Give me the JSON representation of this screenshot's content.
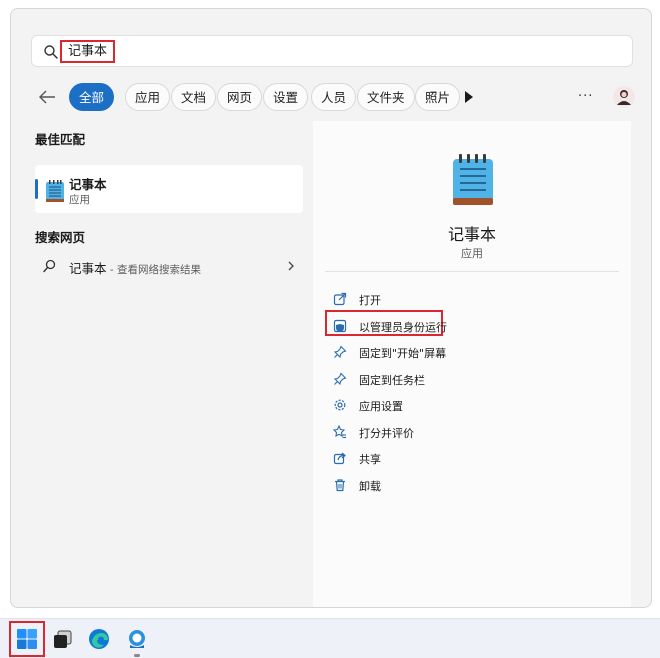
{
  "search": {
    "query": "记事本"
  },
  "filters": {
    "chips": [
      "全部",
      "应用",
      "文档",
      "网页",
      "设置",
      "人员",
      "文件夹",
      "照片"
    ],
    "more": "···"
  },
  "left": {
    "best_match_title": "最佳匹配",
    "best_match": {
      "name": "记事本",
      "type": "应用"
    },
    "web_title": "搜索网页",
    "web_item": {
      "text": "记事本",
      "sub": " - 查看网络搜索结果"
    }
  },
  "detail": {
    "title": "记事本",
    "type": "应用",
    "actions": [
      "打开",
      "以管理员身份运行",
      "固定到\"开始\"屏幕",
      "固定到任务栏",
      "应用设置",
      "打分并评价",
      "共享",
      "卸载"
    ]
  },
  "colors": {
    "accent": "#1d6fc6",
    "highlight": "#d9282f"
  }
}
